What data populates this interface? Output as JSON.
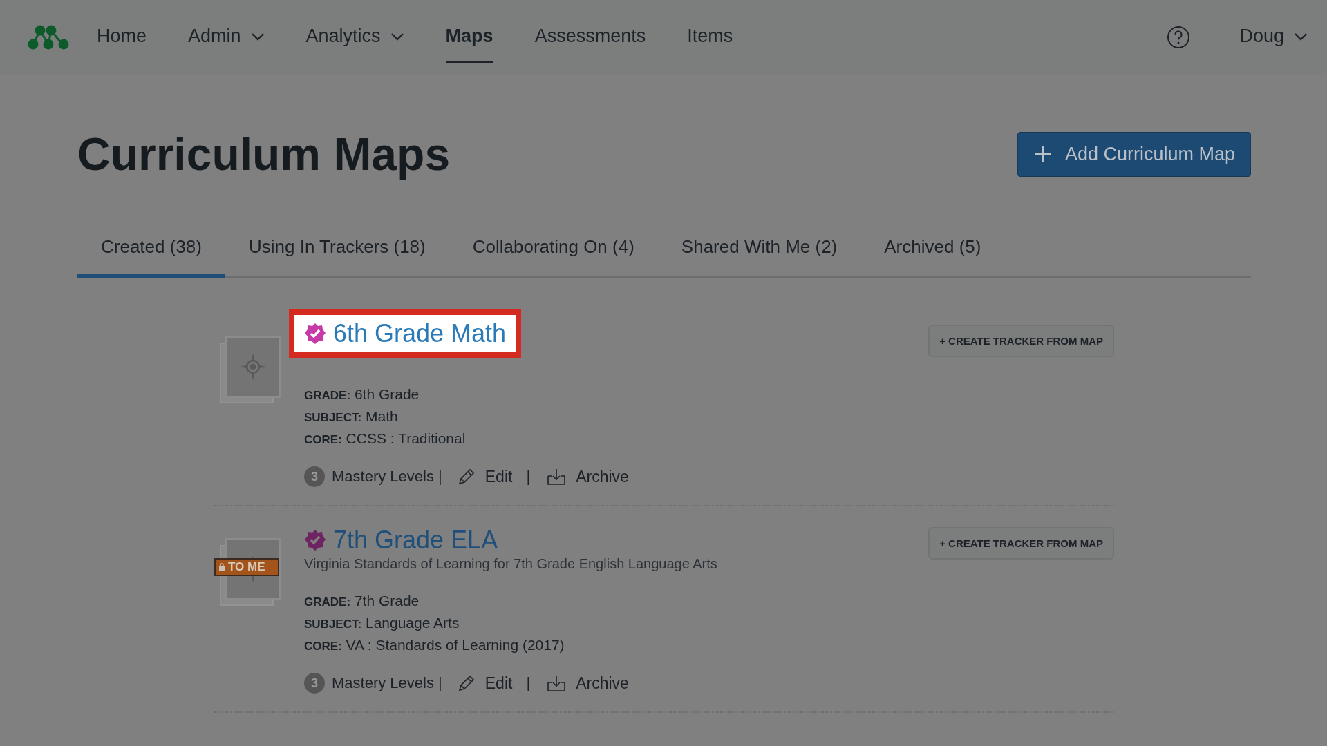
{
  "nav": {
    "items": [
      {
        "label": "Home",
        "dropdown": false,
        "selected": false
      },
      {
        "label": "Admin",
        "dropdown": true,
        "selected": false
      },
      {
        "label": "Analytics",
        "dropdown": true,
        "selected": false
      },
      {
        "label": "Maps",
        "dropdown": false,
        "selected": true
      },
      {
        "label": "Assessments",
        "dropdown": false,
        "selected": false
      },
      {
        "label": "Items",
        "dropdown": false,
        "selected": false
      }
    ],
    "user": "Doug"
  },
  "page": {
    "title": "Curriculum Maps",
    "add_button": "Add Curriculum Map"
  },
  "tabs": [
    {
      "label": "Created (38)",
      "selected": true
    },
    {
      "label": "Using In Trackers (18)",
      "selected": false
    },
    {
      "label": "Collaborating On (4)",
      "selected": false
    },
    {
      "label": "Shared With Me (2)",
      "selected": false
    },
    {
      "label": "Archived (5)",
      "selected": false
    }
  ],
  "maps": [
    {
      "title": "6th Grade Math",
      "highlighted": true,
      "fields": [
        {
          "label": "GRADE:",
          "value": "6th Grade"
        },
        {
          "label": "SUBJECT:",
          "value": "Math"
        },
        {
          "label": "CORE:",
          "value": "CCSS : Traditional"
        }
      ],
      "mastery_count": "3",
      "mastery_label": "Mastery Levels |",
      "edit": "Edit",
      "separator": "|",
      "archive": "Archive",
      "create_button": "+ CREATE TRACKER FROM MAP"
    },
    {
      "title": "7th Grade ELA",
      "highlighted": false,
      "shared_tag": "TO ME",
      "subtitle": "Virginia Standards of Learning for 7th Grade English Language Arts",
      "fields": [
        {
          "label": "GRADE:",
          "value": "7th Grade"
        },
        {
          "label": "SUBJECT:",
          "value": "Language Arts"
        },
        {
          "label": "CORE:",
          "value": "VA : Standards of Learning (2017)"
        }
      ],
      "mastery_count": "3",
      "mastery_label": "Mastery Levels |",
      "edit": "Edit",
      "separator": "|",
      "archive": "Archive",
      "create_button": "+ CREATE TRACKER FROM MAP"
    }
  ]
}
